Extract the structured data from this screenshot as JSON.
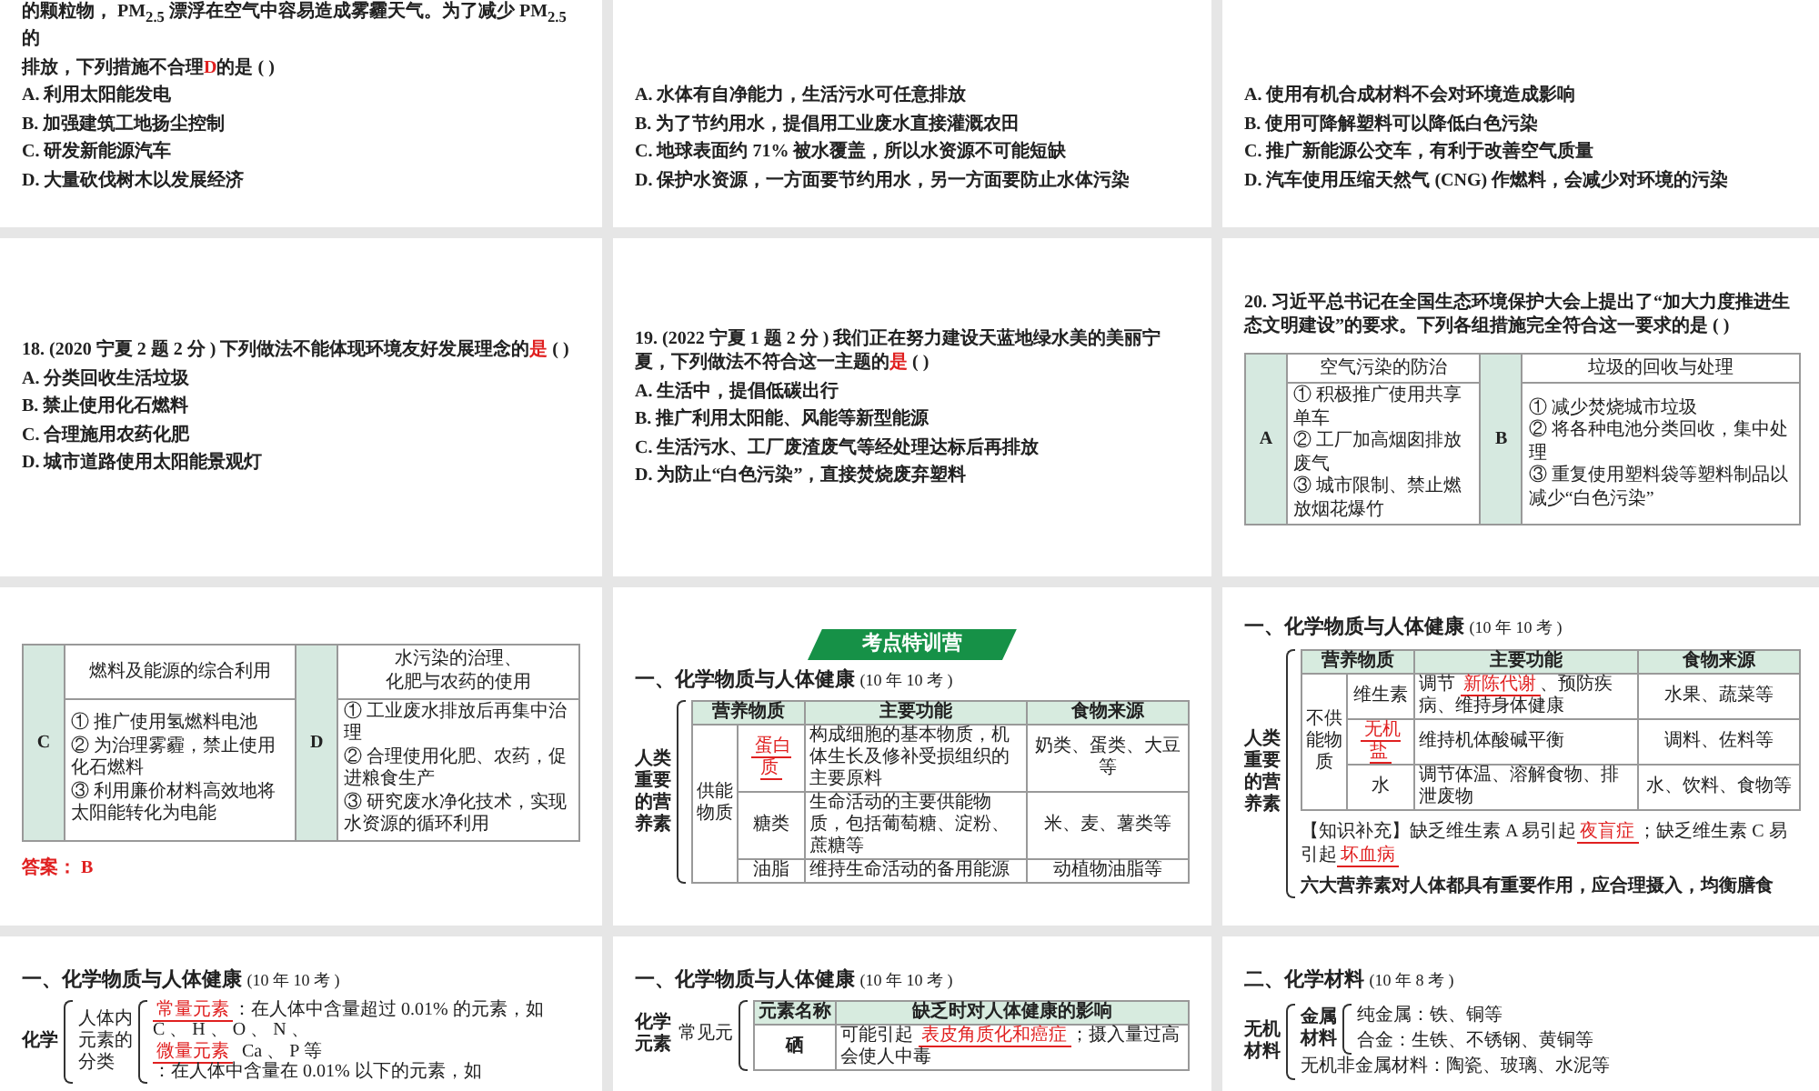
{
  "slides": [
    {
      "kind": "question",
      "stem": [
        [
          {
            "kind": "text",
            "text": "的颗粒物， PM$_{2.5}$ 漂浮在空气中容易造成雾霾天气。为了减少 PM$_{2.5}$ 的"
          }
        ],
        [
          {
            "kind": "text",
            "text": "排放，下列措施不合理"
          },
          {
            "kind": "answer",
            "text": "D"
          },
          {
            "kind": "text",
            "text": "的是 (        )"
          }
        ]
      ],
      "options": [
        "A. 利用太阳能发电",
        "B. 加强建筑工地扬尘控制",
        "C. 研发新能源汽车",
        "D. 大量砍伐树木以发展经济"
      ]
    },
    {
      "kind": "question",
      "options": [
        "A. 水体有自净能力，生活污水可任意排放",
        "B. 为了节约用水，提倡用工业废水直接灌溉农田",
        "C. 地球表面约 71% 被水覆盖，所以水资源不可能短缺",
        "D. 保护水资源，一方面要节约用水，另一方面要防止水体污染"
      ]
    },
    {
      "kind": "question",
      "options": [
        "A. 使用有机合成材料不会对环境造成影响",
        "B. 使用可降解塑料可以降低白色污染",
        "C. 推广新能源公交车，有利于改善空气质量",
        "D. 汽车使用压缩天然气 (CNG) 作燃料，会减少对环境的污染"
      ]
    },
    {
      "kind": "question",
      "stem": [
        [
          {
            "kind": "text",
            "text": "18. **(2020 宁夏 2 题 2 分 )** 下列做法不能体现环境友好发展理念的"
          },
          {
            "kind": "answer",
            "text": "是"
          },
          {
            "kind": "text",
            "text": " (  )"
          }
        ]
      ],
      "options": [
        "A. 分类回收生活垃圾",
        "B. 禁止使用化石燃料",
        "C. 合理施用农药化肥",
        "D. 城市道路使用太阳能景观灯"
      ]
    },
    {
      "kind": "question",
      "stem": [
        [
          {
            "kind": "text",
            "text": "19. **(2022 宁夏 1 题 2 分 )** 我们正在努力建设天蓝地绿水美的美丽宁夏，下列做法不符合这一主题的"
          },
          {
            "kind": "answer",
            "text": "是"
          },
          {
            "kind": "text",
            "text": " (        )"
          }
        ]
      ],
      "options": [
        "A. 生活中，提倡低碳出行",
        "B. 推广利用太阳能、风能等新型能源",
        "C. 生活污水、工厂废渣废气等经处理达标后再排放",
        "D. 为防止“白色污染”，直接焚烧废弃塑料"
      ]
    },
    {
      "kind": "choice_table",
      "stem": [
        [
          {
            "kind": "text",
            "text": "20. 习近平总书记在全国生态环境保护大会上提出了“加大力度推进生态文明建设”的要求。下列各组措施完全符合这一要求的是 (        )"
          }
        ]
      ],
      "groups": [
        {
          "letter": "A",
          "title": [
            "空气污染的防治"
          ],
          "items": [
            "① 积极推广使用共享单车",
            "② 工厂加高烟囱排放废气",
            "③ 城市限制、禁止燃放烟花爆竹"
          ]
        },
        {
          "letter": "B",
          "title": [
            "垃圾的回收与处理"
          ],
          "items": [
            "① 减少焚烧城市垃圾",
            "② 将各种电池分类回收，集中处理",
            "③ 重复使用塑料袋等塑料制品以减少“白色污染”"
          ]
        }
      ]
    },
    {
      "kind": "choice_table",
      "groups": [
        {
          "letter": "C",
          "title": [
            "燃料及能源的综合利用"
          ],
          "items": [
            "① 推广使用氢燃料电池",
            "② 为治理雾霾，禁止使用化石燃料",
            "③ 利用廉价材料高效地将太阳能转化为电能"
          ]
        },
        {
          "letter": "D",
          "title": [
            "水污染的治理、",
            "化肥与农药的使用"
          ],
          "items": [
            "① 工业废水排放后再集中治理",
            "② 合理使用化肥、农药，促进粮食生产",
            "③ 研究废水净化技术，实现水资源的循环利用"
          ]
        }
      ],
      "answer": {
        "label": "答案：",
        "value": "B"
      }
    },
    {
      "kind": "nutrition",
      "banner": "考点特训营",
      "heading": {
        "title": "一、化学物质与人体健康",
        "note": "(10 年 10 考 )"
      },
      "side_label": "人类重要的营养素",
      "columns": [
        "营养物质",
        "主要功能",
        "食物来源"
      ],
      "group": "供能物质",
      "rows": [
        {
          "name": [
            {
              "kind": "blank",
              "text": "蛋白质"
            }
          ],
          "function": [
            {
              "kind": "text",
              "text": "构成细胞的基本物质，机体生长及修补受损组织的主要原料"
            }
          ],
          "source": "奶类、蛋类、大豆等"
        },
        {
          "name": [
            {
              "kind": "text",
              "text": "糖类"
            }
          ],
          "function": [
            {
              "kind": "text",
              "text": "生命活动的主要供能物质，包括葡萄糖、淀粉、蔗糖等"
            }
          ],
          "source": "米、麦、薯类等"
        },
        {
          "name": [
            {
              "kind": "text",
              "text": "油脂"
            }
          ],
          "function": [
            {
              "kind": "text",
              "text": "维持生命活动的备用能源"
            }
          ],
          "source": "动植物油脂等"
        }
      ]
    },
    {
      "kind": "nutrition",
      "heading": {
        "title": "一、化学物质与人体健康",
        "note": "(10 年 10 考 )"
      },
      "side_label": "人类重要的营养素",
      "columns": [
        "营养物质",
        "主要功能",
        "食物来源"
      ],
      "group": "不供能物质",
      "rows": [
        {
          "name": [
            {
              "kind": "text",
              "text": "维生素"
            }
          ],
          "function": [
            {
              "kind": "text",
              "text": "调节 "
            },
            {
              "kind": "blank",
              "text": "新陈代谢"
            },
            {
              "kind": "text",
              "text": "、预防疾病、维持身体健康"
            }
          ],
          "source": "水果、蔬菜等"
        },
        {
          "name": [
            {
              "kind": "blank",
              "text": "无机盐"
            }
          ],
          "function": [
            {
              "kind": "text",
              "text": "维持机体酸碱平衡"
            }
          ],
          "source": "调料、佐料等"
        },
        {
          "name": [
            {
              "kind": "text",
              "text": "水"
            }
          ],
          "function": [
            {
              "kind": "text",
              "text": "调节体温、溶解食物、排泄废物"
            }
          ],
          "source": "水、饮料、食物等"
        }
      ],
      "note": [
        {
          "kind": "text",
          "text": "【知识补充】缺乏维生素 A 易引起"
        },
        {
          "kind": "blank",
          "text": "夜盲症"
        },
        {
          "kind": "text",
          "text": "；缺乏维生素 C 易引起"
        },
        {
          "kind": "blank",
          "text": "坏血病"
        }
      ],
      "summary": "六大营养素对人体都具有重要作用，应合理摄入，均衡膳食"
    },
    {
      "kind": "classification",
      "heading": {
        "title": "一、化学物质与人体健康",
        "note": "(10 年 10 考 )"
      },
      "root": "化学",
      "branch": "人体内元素的分类",
      "lines": [
        [
          {
            "kind": "blank",
            "text": "常量元素"
          },
          {
            "kind": "text",
            "text": "：在人体中含量超过 0.01% 的元素，如"
          }
        ],
        [
          {
            "kind": "text",
            "text": "C 、 H 、 O 、 N 、"
          }
        ],
        [
          {
            "kind": "blank",
            "text": "微量元素"
          },
          {
            "kind": "text",
            "text": "  Ca 、 P 等"
          }
        ],
        [
          {
            "kind": "text",
            "text": "：在人体中含量在 0.01% 以下的元素，如"
          }
        ]
      ]
    },
    {
      "kind": "element_table",
      "heading": {
        "title": "一、化学物质与人体健康",
        "note": "(10 年 10 考 )"
      },
      "root": "化学元素",
      "branch": "常见元",
      "columns": [
        "元素名称",
        "缺乏时对人体健康的影响"
      ],
      "rows": [
        {
          "name": "硒",
          "effect": [
            {
              "kind": "text",
              "text": "可能引起 "
            },
            {
              "kind": "blank",
              "text": "表皮角质化和癌症"
            },
            {
              "kind": "text",
              "text": "；摄入量过高会使人中毒"
            }
          ]
        }
      ]
    },
    {
      "kind": "tree",
      "heading": {
        "title": "二、化学材料",
        "note": "(10 年 8 考 )"
      },
      "root": "无机材料",
      "children": [
        {
          "label": "金属材料",
          "children": [
            {
              "label": "纯金属：铁、铜等"
            },
            {
              "label": "合金：生铁、不锈钢、黄铜等"
            }
          ]
        },
        {
          "label": "无机非金属材料：陶瓷、玻璃、水泥等"
        }
      ]
    }
  ]
}
